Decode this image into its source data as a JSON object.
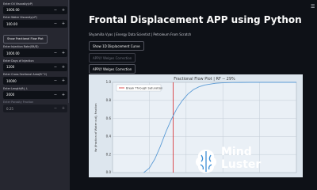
{
  "sidebar": {
    "fields": [
      {
        "label": "Enter Oil Viscosity(cP)",
        "value": "1000.00",
        "dim": false
      },
      {
        "label": "Enter Water Viscosity(cP)",
        "value": "100.00",
        "dim": false
      }
    ],
    "button_flow_plot": "Show Fractional Flow Plot",
    "fields2": [
      {
        "label": "Enter Injection Rate(Sft/D)",
        "value": "1000.00",
        "dim": false
      },
      {
        "label": "Enter Days of Injection",
        "value": "1200",
        "dim": false
      },
      {
        "label": "Enter Cross Sectional Area(ft^2)",
        "value": "10000",
        "dim": false
      },
      {
        "label": "Enter Length(ft), L",
        "value": "2000",
        "dim": false
      },
      {
        "label": "Enter Porosity Fraction",
        "value": "0.25",
        "dim": true
      }
    ],
    "minus": "−",
    "plus": "+"
  },
  "header": {
    "title": "Frontal Displacement APP using Python",
    "byline": "Shyamilla Vyas | Energy Data Scientist | Petroleum From Scratch",
    "menu_icon": "☰",
    "deploy_label": "⋮"
  },
  "buttons": {
    "show_1d": "Show 1D Displacement Curve",
    "welge_dim": "APPLY Welges Correction",
    "welge": "APPLY Welges Correction"
  },
  "chart_data": {
    "type": "line",
    "title": "Fractional Flow Plot | RF -- 29%",
    "xlabel": "",
    "ylabel": "fw (fraction of Water cut), fraction",
    "ylim": [
      0.0,
      1.0
    ],
    "yticks": [
      0.0,
      0.2,
      0.4,
      0.6,
      0.8,
      1.0
    ],
    "series": [
      {
        "name": "",
        "color": "#5b9bd5",
        "x": [
          0.17,
          0.2,
          0.23,
          0.26,
          0.29,
          0.32,
          0.35,
          0.38,
          0.41,
          0.44,
          0.47,
          0.5,
          0.53,
          0.56,
          0.6,
          0.65,
          0.7,
          0.75,
          0.8,
          0.85,
          0.9,
          0.95,
          1.0
        ],
        "y": [
          0.0,
          0.05,
          0.15,
          0.29,
          0.45,
          0.59,
          0.71,
          0.8,
          0.87,
          0.92,
          0.95,
          0.97,
          0.98,
          0.99,
          0.995,
          0.998,
          0.999,
          1.0,
          1.0,
          1.0,
          1.0,
          1.0,
          1.0
        ]
      }
    ],
    "xlim": [
      0.0,
      1.0
    ],
    "breakthrough": {
      "label": "Break Through Saturation",
      "x": 0.33,
      "color": "#d62728"
    },
    "grid": true
  },
  "logo": {
    "line1": "Mind",
    "line2": "Luster"
  }
}
